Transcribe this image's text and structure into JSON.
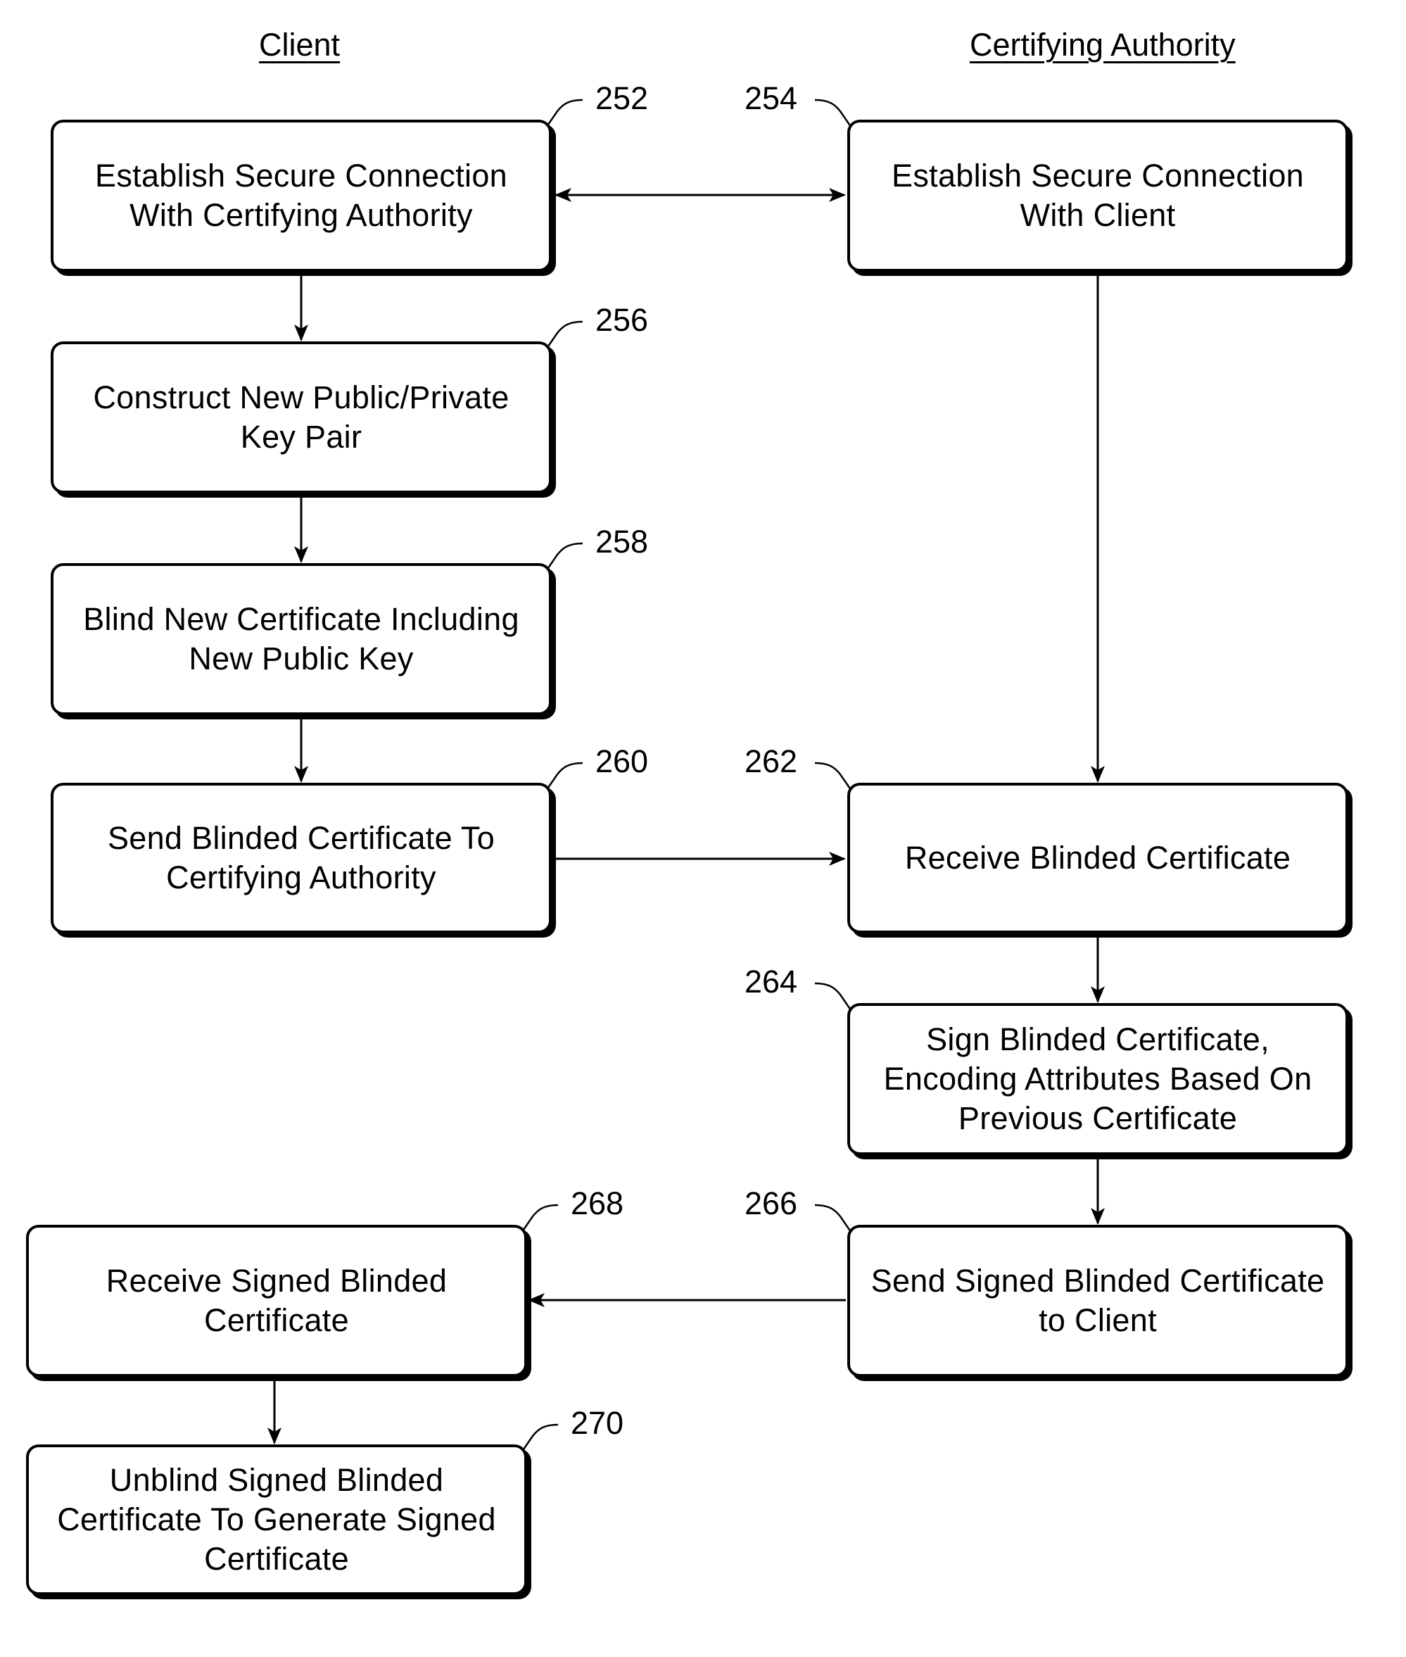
{
  "headings": {
    "client": "Client",
    "authority": "Certifying Authority"
  },
  "steps": [
    {
      "id": "252",
      "column": "client",
      "text": "Establish Secure Connection\nWith Certifying Authority"
    },
    {
      "id": "254",
      "column": "authority",
      "text": "Establish Secure Connection\nWith Client"
    },
    {
      "id": "256",
      "column": "client",
      "text": "Construct New Public/Private\nKey Pair"
    },
    {
      "id": "258",
      "column": "client",
      "text": "Blind New Certificate Including\nNew Public Key"
    },
    {
      "id": "260",
      "column": "client",
      "text": "Send Blinded Certificate To\nCertifying Authority"
    },
    {
      "id": "262",
      "column": "authority",
      "text": "Receive Blinded Certificate"
    },
    {
      "id": "264",
      "column": "authority",
      "text": "Sign Blinded Certificate,\nEncoding Attributes Based On\nPrevious Certificate"
    },
    {
      "id": "266",
      "column": "authority",
      "text": "Send Signed Blinded Certificate\nto Client"
    },
    {
      "id": "268",
      "column": "client",
      "text": "Receive Signed Blinded\nCertificate"
    },
    {
      "id": "270",
      "column": "client",
      "text": "Unblind Signed Blinded\nCertificate To Generate Signed\nCertificate"
    }
  ],
  "connections": [
    {
      "from": "252",
      "to": "254",
      "type": "bidirectional"
    },
    {
      "from": "252",
      "to": "256"
    },
    {
      "from": "256",
      "to": "258"
    },
    {
      "from": "258",
      "to": "260"
    },
    {
      "from": "254",
      "to": "262"
    },
    {
      "from": "260",
      "to": "262"
    },
    {
      "from": "262",
      "to": "264"
    },
    {
      "from": "264",
      "to": "266"
    },
    {
      "from": "266",
      "to": "268"
    },
    {
      "from": "268",
      "to": "270"
    }
  ]
}
